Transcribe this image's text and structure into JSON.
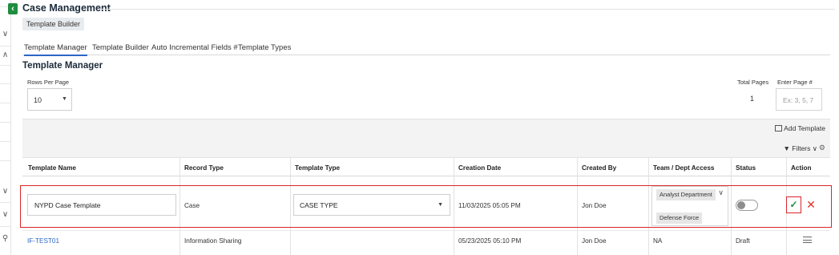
{
  "app": {
    "title": "Case Management",
    "breadcrumb": "Template Builder"
  },
  "tabs": [
    {
      "label": "Template Manager",
      "active": true
    },
    {
      "label": "Template Builder",
      "active": false
    },
    {
      "label": "Auto Incremental Fields #",
      "active": false
    },
    {
      "label": "Template Types",
      "active": false
    }
  ],
  "section": {
    "title": "Template Manager"
  },
  "pagination": {
    "rows_label": "Rows Per Page",
    "rows_value": "10",
    "total_pages_label": "Total Pages",
    "total_pages_value": "1",
    "enter_page_label": "Enter Page #",
    "enter_page_placeholder": "Ex: 3, 5, 7"
  },
  "toolbar": {
    "add_template": "Add Template",
    "filters": "Filters"
  },
  "table": {
    "columns": [
      "Template Name",
      "Record Type",
      "Template Type",
      "Creation Date",
      "Created By",
      "Team / Dept Access",
      "Status",
      "Action"
    ],
    "edit_row": {
      "template_name": "NYPD Case Template",
      "record_type": "Case",
      "template_type": "CASE TYPE",
      "creation_date": "11/03/2025 05:05 PM",
      "created_by": "Jon Doe",
      "team_chips": [
        "Analyst Department",
        "Defense Force"
      ],
      "status_on": false
    },
    "rows": [
      {
        "template_name": "IF-TEST01",
        "record_type": "Information Sharing",
        "template_type": "",
        "creation_date": "05/23/2025 05:10 PM",
        "created_by": "Jon Doe",
        "team": "NA",
        "status": "Draft"
      }
    ]
  },
  "colors": {
    "accent": "#2c66c5",
    "highlight": "#d9262c",
    "success": "#1e8e3e"
  }
}
